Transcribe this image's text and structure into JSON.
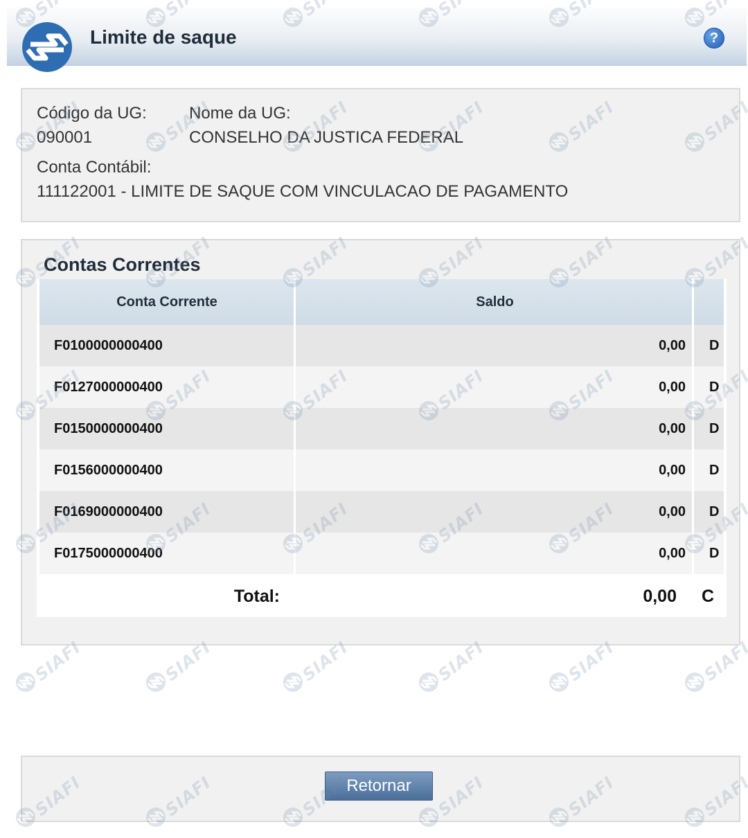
{
  "header": {
    "title": "Limite de saque",
    "help_icon": "question-circle-icon",
    "logo_icon": "siafi-logo-icon"
  },
  "info": {
    "codigo_label": "Código da UG:",
    "codigo_value": "090001",
    "nome_label": "Nome da UG:",
    "nome_value": "CONSELHO DA JUSTICA FEDERAL",
    "conta_label": "Conta Contábil:",
    "conta_value": "111122001 - LIMITE DE SAQUE COM VINCULACAO DE PAGAMENTO"
  },
  "contas": {
    "title": "Contas Correntes",
    "headers": {
      "conta": "Conta Corrente",
      "saldo": "Saldo"
    },
    "rows": [
      {
        "conta": "F0100000000400",
        "saldo": "0,00",
        "dc": "D"
      },
      {
        "conta": "F0127000000400",
        "saldo": "0,00",
        "dc": "D"
      },
      {
        "conta": "F0150000000400",
        "saldo": "0,00",
        "dc": "D"
      },
      {
        "conta": "F0156000000400",
        "saldo": "0,00",
        "dc": "D"
      },
      {
        "conta": "F0169000000400",
        "saldo": "0,00",
        "dc": "D"
      },
      {
        "conta": "F0175000000400",
        "saldo": "0,00",
        "dc": "D"
      }
    ],
    "total": {
      "label": "Total:",
      "value": "0,00",
      "dc": "C"
    }
  },
  "footer": {
    "retornar_label": "Retornar"
  },
  "watermark": {
    "text": "SIAFI"
  },
  "colors": {
    "accent": "#4a6f9a",
    "header_border": "#e8c56a",
    "help": "#1f5cb8"
  }
}
